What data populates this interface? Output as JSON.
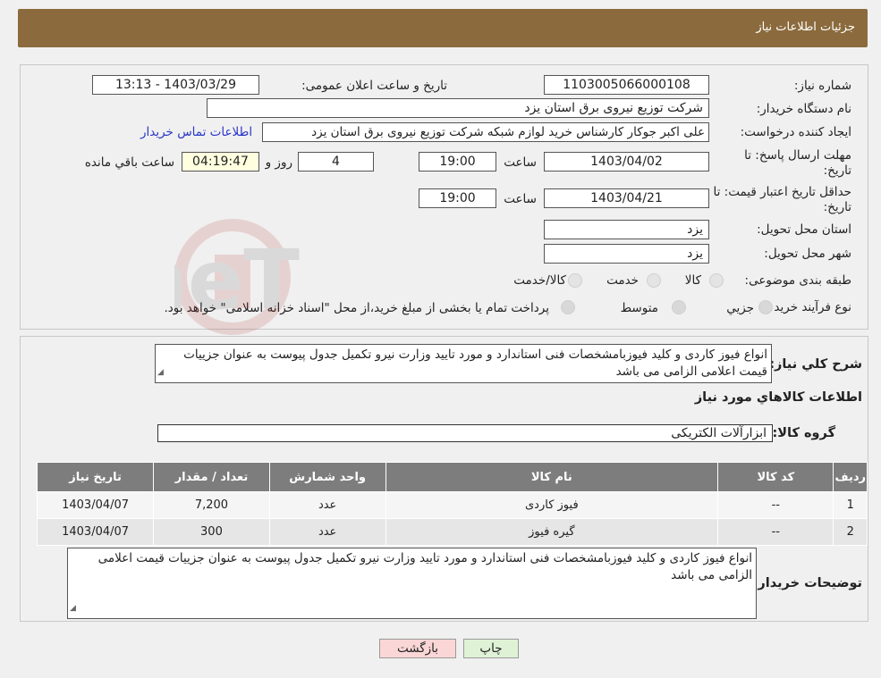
{
  "header": {
    "title": "جزئیات اطلاعات نیاز"
  },
  "form": {
    "need_number": {
      "label": "شماره نیاز:",
      "value": "1103005066000108"
    },
    "announce_datetime": {
      "label": "تاریخ و ساعت اعلان عمومی:",
      "value": "1403/03/29 - 13:13"
    },
    "buyer_org": {
      "label": "نام دستگاه خریدار:",
      "value": "شرکت توزیع نیروی برق استان یزد"
    },
    "requester": {
      "label": "ایجاد کننده درخواست:",
      "value": "علی اکبر  جوکار  کارشناس خرید لوازم شبکه  شرکت توزیع نیروی برق استان یزد",
      "link": "اطلاعات تماس خریدار"
    },
    "reply_deadline": {
      "label": "مهلت ارسال پاسخ: تا تاریخ:",
      "date": "1403/04/02",
      "time_label": "ساعت",
      "time": "19:00",
      "days": "4",
      "days_label": "روز و",
      "remaining": "04:19:47",
      "remaining_label": "ساعت باقي مانده"
    },
    "price_validity": {
      "label": "حداقل تاریخ اعتبار قیمت: تا تاریخ:",
      "date": "1403/04/21",
      "time_label": "ساعت",
      "time": "19:00"
    },
    "province": {
      "label": "استان محل تحویل:",
      "value": "یزد"
    },
    "city": {
      "label": "شهر محل تحویل:",
      "value": "یزد"
    },
    "category": {
      "label": "طبقه بندی موضوعی:",
      "options": [
        "کالا",
        "خدمت",
        "کالا/خدمت"
      ]
    },
    "purchase_type": {
      "label": "نوع فرآیند خرید :",
      "options": [
        "جزيي",
        "متوسط"
      ],
      "note": "پرداخت تمام یا بخشی از مبلغ خرید،از محل \"اسناد خزانه اسلامی\" خواهد بود."
    }
  },
  "details": {
    "description_label": "شرح کلي نياز:",
    "description": "انواع فیوز کاردی و کلید فیوزبامشخصات فنی  استاندارد و مورد تایید وزارت نیرو تکمیل جدول پیوست به عنوان جزییات قیمت اعلامی الزامی می باشد",
    "items_title": "اطلاعات کالاهاي مورد نياز",
    "group_label": "گروه کالا:",
    "group_value": "ابزارآلات الکتریکی",
    "table": {
      "headers": [
        "رديف",
        "کد کالا",
        "نام کالا",
        "واحد شمارش",
        "تعداد / مقدار",
        "تاریخ نیاز"
      ],
      "rows": [
        [
          "1",
          "--",
          "فیوز کاردی",
          "عدد",
          "7,200",
          "1403/04/07"
        ],
        [
          "2",
          "--",
          "گیره فیوز",
          "عدد",
          "300",
          "1403/04/07"
        ]
      ]
    },
    "buyer_notes_label": "توضیحات خریدار:",
    "buyer_notes": "انواع فیوز کاردی و کلید فیوزبامشخصات فنی  استاندارد و مورد تایید وزارت نیرو تکمیل جدول پیوست به عنوان جزییات قیمت اعلامی الزامی می باشد"
  },
  "buttons": {
    "print": "چاپ",
    "back": "بازگشت"
  },
  "watermark": {
    "text": "AriaTender.neT"
  }
}
